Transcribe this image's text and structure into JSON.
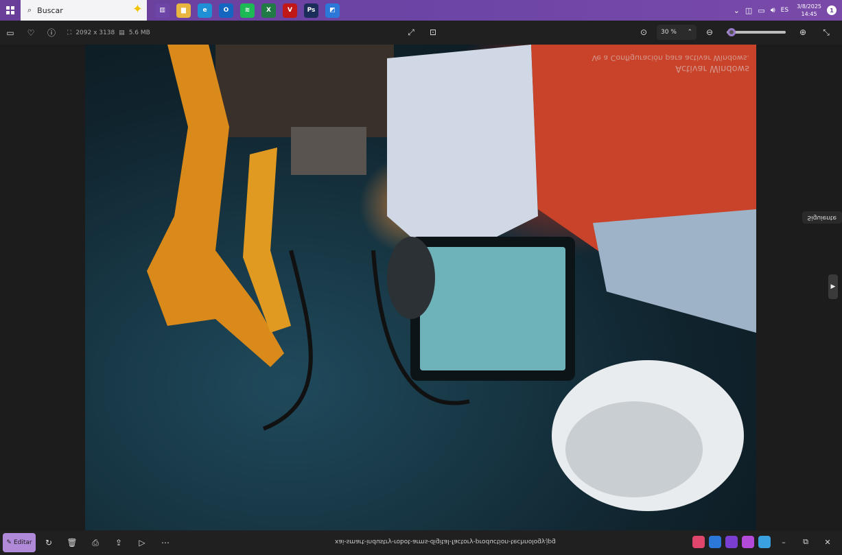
{
  "taskbar": {
    "search_label": "Buscar",
    "apps": [
      {
        "name": "widgets-icon",
        "color": "#6c45a6",
        "glyph": "▥"
      },
      {
        "name": "file-explorer-icon",
        "color": "#e7b540",
        "glyph": "▆"
      },
      {
        "name": "edge-icon",
        "color": "#1f8fd6",
        "glyph": "e"
      },
      {
        "name": "outlook-icon",
        "color": "#1466c0",
        "glyph": "O"
      },
      {
        "name": "spotify-icon",
        "color": "#1db954",
        "glyph": "≋"
      },
      {
        "name": "excel-icon",
        "color": "#1f7a43",
        "glyph": "X"
      },
      {
        "name": "vivaldi-icon",
        "color": "#c01818",
        "glyph": "V"
      },
      {
        "name": "photoshop-icon",
        "color": "#1b2d5a",
        "glyph": "Ps"
      },
      {
        "name": "photos-icon",
        "color": "#2b78d8",
        "glyph": "◩"
      }
    ],
    "tray": {
      "lang": "ES",
      "date": "3/8/2025",
      "time": "14:45",
      "notifications": "1"
    }
  },
  "toolbar": {
    "dimensions": "2092 x 3138",
    "filesize": "5.6 MB",
    "zoom": "30 %",
    "zoom_fraction": 0.03
  },
  "photo": {
    "watermark_line1": "Activar Windows",
    "watermark_line2": "Ve a Configuración para activar Windows."
  },
  "side": {
    "tooltip": "Siguiente"
  },
  "bottombar": {
    "edit_label": "Editar",
    "filename": "xai-smart-industry-robot-arms-digital-factory-production-technology.jpg"
  },
  "colors": {
    "accent": "#b08ad8",
    "taskbar": "#6a3f9a"
  }
}
